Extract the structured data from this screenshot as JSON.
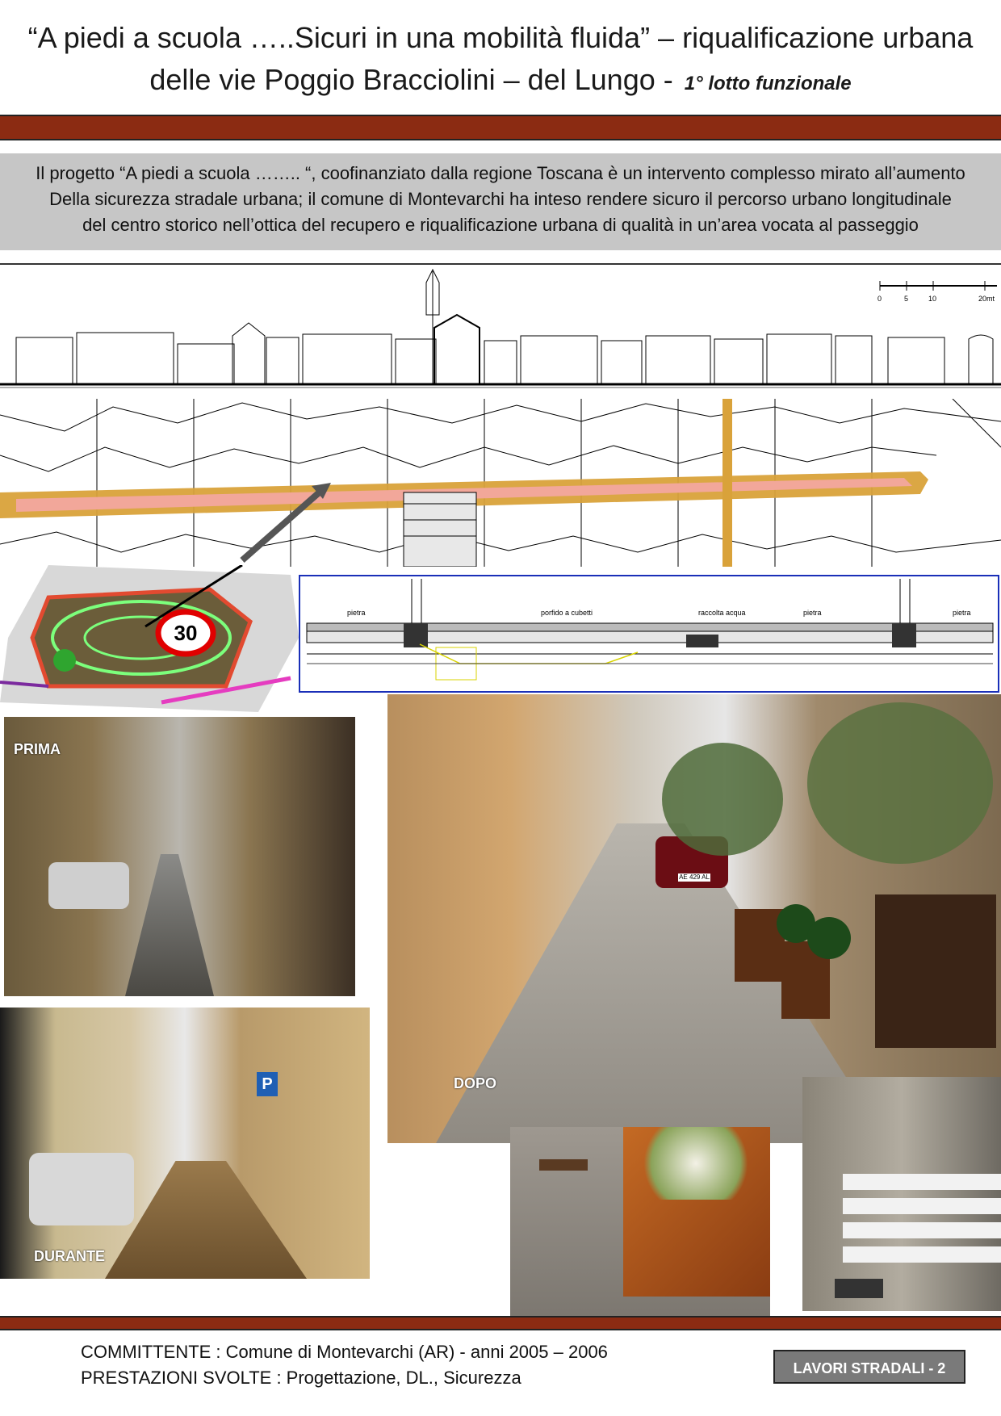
{
  "header": {
    "title_line1": "“A piedi a scuola …..Sicuri in una mobilità fluida” – riqualificazione urbana",
    "title_line2": "delle vie Poggio Bracciolini – del Lungo -",
    "subtitle": "1° lotto funzionale"
  },
  "intro": {
    "lines": [
      "Il progetto “A piedi a scuola …….. “, coofinanziato dalla regione Toscana è un intervento complesso mirato all’aumento",
      "Della sicurezza stradale urbana; il comune di Montevarchi ha inteso rendere sicuro il percorso urbano longitudinale",
      "del centro storico nell’ottica del recupero e riqualificazione urbana di qualità in un’area vocata al passeggio"
    ]
  },
  "scale_bar": {
    "labels": [
      "0",
      "5",
      "10",
      "20mt"
    ]
  },
  "speed_sign": {
    "value": "30"
  },
  "section_drawing": {
    "labels": [
      "pietra",
      "porfido a cubetti",
      "raccolta acqua",
      "pietra",
      "pietra"
    ]
  },
  "photos": {
    "prima": "PRIMA",
    "durante": "DURANTE",
    "dopo": "DOPO",
    "parking_sign": "P",
    "car_plate": "AE 429 AL"
  },
  "footer": {
    "committente": "COMMITTENTE : Comune di Montevarchi (AR)  -  anni 2005 – 2006",
    "prestazioni": "PRESTAZIONI SVOLTE : Progettazione, DL., Sicurezza",
    "badge": "LAVORI STRADALI - 2"
  },
  "colors": {
    "accent_bar": "#8b2b12",
    "intro_bg": "#c6c6c6",
    "badge_bg": "#7a7a7a",
    "road_ochre": "#d9a23a",
    "road_pink": "#f2a79a",
    "section_frame": "#1a2fb8"
  }
}
